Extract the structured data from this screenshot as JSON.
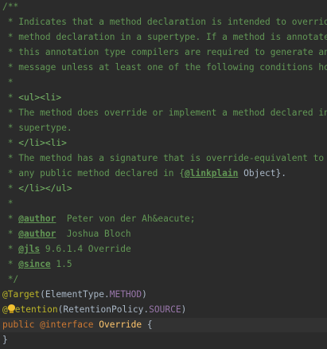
{
  "editor": {
    "lines": {
      "l1": "/**",
      "l2": " * Indicates that a method declaration is intended to override a",
      "l3": " * method declaration in a supertype. If a method is annotated with",
      "l4": " * this annotation type compilers are required to generate an error",
      "l5": " * message unless at least one of the following conditions hold:",
      "l6": " *",
      "l7_prefix": " * ",
      "l7_tag": "<ul><li>",
      "l8": " * The method does override or implement a method declared in a",
      "l9": " * supertype.",
      "l10_prefix": " * ",
      "l10_tag": "</li><li>",
      "l11": " * The method has a signature that is override-equivalent to that of",
      "l12_prefix": " * any public method declared in {",
      "l12_tag": "@linkplain",
      "l12_suffix": " Object}.",
      "l13_prefix": " * ",
      "l13_tag": "</li></ul>",
      "l14": " *",
      "l15_prefix": " * ",
      "l15_tag": "@author",
      "l15_value": "  Peter von der Ah&eacute;",
      "l16_prefix": " * ",
      "l16_tag": "@author",
      "l16_value": "  Joshua Bloch",
      "l17_prefix": " * ",
      "l17_tag": "@jls",
      "l17_value": " 9.6.1.4 Override",
      "l18_prefix": " * ",
      "l18_tag": "@since",
      "l18_value": " 1.5",
      "l19": " */",
      "l20_ann": "@Target",
      "l20_open": "(ElementType.",
      "l20_const": "METHOD",
      "l20_close": ")",
      "l21_at": "@",
      "l21_ann": "etention",
      "l21_open": "(RetentionPolicy.",
      "l21_const": "SOURCE",
      "l21_close": ")",
      "l22_kw1": "public",
      "l22_kw2": " @interface",
      "l22_name": " Override",
      "l22_rest": " {",
      "l23": "}"
    },
    "icons": {
      "intention": "lightbulb-icon"
    },
    "colors": {
      "background": "#2b2b2b",
      "comment": "#629755",
      "annotation": "#bbb529",
      "keyword": "#cc7832",
      "constant": "#9876aa",
      "class_name": "#ffc66d",
      "text": "#a9b7c6",
      "current_line": "#323232"
    }
  }
}
